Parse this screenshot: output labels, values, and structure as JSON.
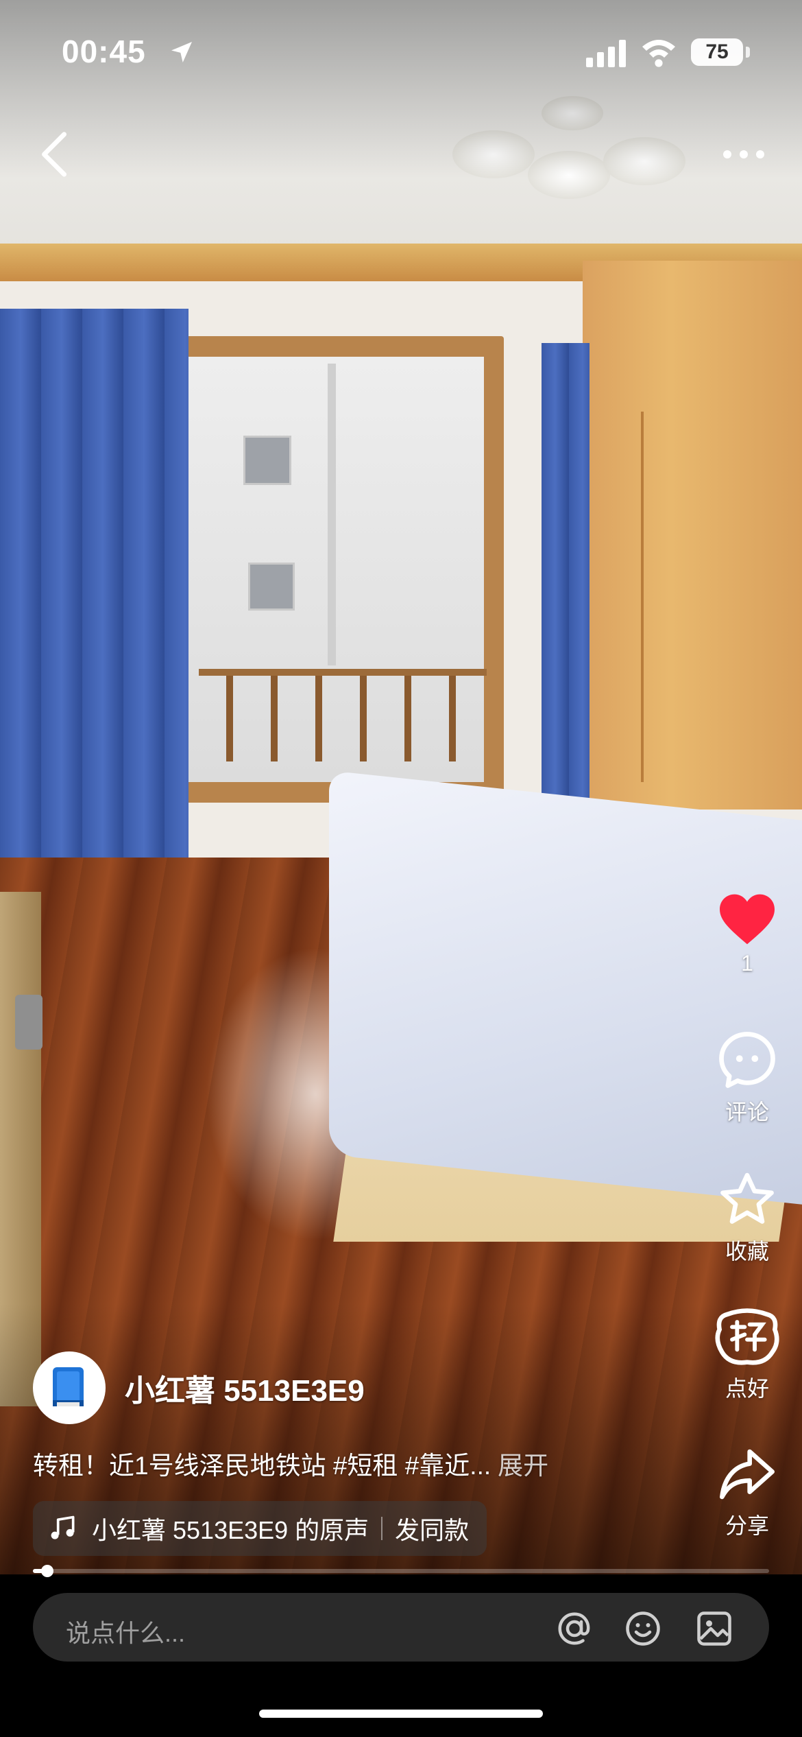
{
  "status_bar": {
    "time": "00:45",
    "battery": "75"
  },
  "video": {
    "description_icons": [
      "back-icon",
      "more-icon"
    ]
  },
  "actions": {
    "like_count": "1",
    "comment_label": "评论",
    "collect_label": "收藏",
    "good_label": "点好",
    "share_label": "分享"
  },
  "author": {
    "name": "小红薯 5513E3E9"
  },
  "caption": {
    "text": "转租！近1号线泽民地铁站 ",
    "tag1": "#短租",
    "tag2": "#靠近...",
    "expand": "展开"
  },
  "music": {
    "label": "小红薯 5513E3E9 的原声",
    "action": "发同款"
  },
  "progress": {
    "fraction": 0.02
  },
  "comment": {
    "placeholder": "说点什么..."
  },
  "colors": {
    "like": "#ff2442",
    "bar_bg": "#2a2a2a"
  }
}
